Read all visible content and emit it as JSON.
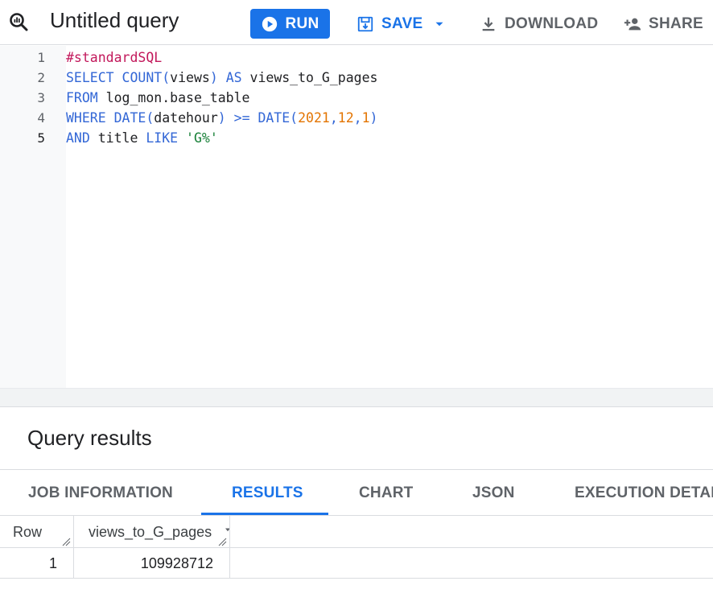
{
  "header": {
    "title": "Untitled query",
    "run_label": "RUN",
    "save_label": "SAVE",
    "download_label": "DOWNLOAD",
    "share_label": "SHARE"
  },
  "editor": {
    "line_numbers": [
      "1",
      "2",
      "3",
      "4",
      "5"
    ],
    "active_line": 5,
    "lines": [
      [
        {
          "t": "#standardSQL",
          "c": "cmt"
        }
      ],
      [
        {
          "t": "SELECT ",
          "c": "kw"
        },
        {
          "t": "COUNT(",
          "c": "kw"
        },
        {
          "t": "views",
          "c": ""
        },
        {
          "t": ") ",
          "c": "kw"
        },
        {
          "t": "AS ",
          "c": "kw"
        },
        {
          "t": "views_to_G_pages",
          "c": ""
        }
      ],
      [
        {
          "t": "FROM ",
          "c": "kw"
        },
        {
          "t": "log_mon.base_table",
          "c": ""
        }
      ],
      [
        {
          "t": "WHERE ",
          "c": "kw"
        },
        {
          "t": "DATE(",
          "c": "kw"
        },
        {
          "t": "datehour",
          "c": ""
        },
        {
          "t": ") >= ",
          "c": "kw"
        },
        {
          "t": "DATE(",
          "c": "kw"
        },
        {
          "t": "2021",
          "c": "num"
        },
        {
          "t": ",",
          "c": "kw"
        },
        {
          "t": "12",
          "c": "num"
        },
        {
          "t": ",",
          "c": "kw"
        },
        {
          "t": "1",
          "c": "num"
        },
        {
          "t": ")",
          "c": "kw"
        }
      ],
      [
        {
          "t": "AND ",
          "c": "kw"
        },
        {
          "t": "title ",
          "c": ""
        },
        {
          "t": "LIKE ",
          "c": "kw"
        },
        {
          "t": "'G%'",
          "c": "str"
        }
      ]
    ]
  },
  "results": {
    "title": "Query results",
    "tabs": [
      {
        "label": "JOB INFORMATION",
        "active": false
      },
      {
        "label": "RESULTS",
        "active": true
      },
      {
        "label": "CHART",
        "active": false
      },
      {
        "label": "JSON",
        "active": false
      },
      {
        "label": "EXECUTION DETAILS",
        "active": false
      }
    ],
    "columns": [
      "Row",
      "views_to_G_pages"
    ],
    "rows": [
      {
        "row": "1",
        "views_to_G_pages": "109928712"
      }
    ]
  },
  "colors": {
    "accent": "#1a73e8",
    "keyword": "#3367d6",
    "comment": "#c2185b",
    "number": "#e37400",
    "string": "#188038"
  }
}
